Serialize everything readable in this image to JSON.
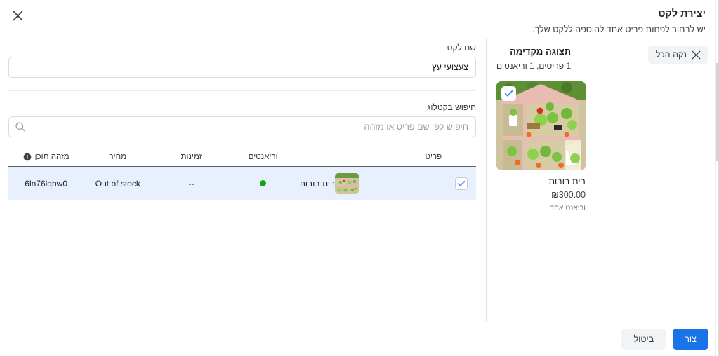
{
  "header": {
    "title": "יצירת לקט",
    "subtitle": "יש לבחור לפחות פריט אחד להוספה ללקט שלך.",
    "close_label": "×"
  },
  "form": {
    "name_label": "שם לקט",
    "name_value": "צעצועי עץ",
    "search_label": "חיפוש בקטלוג",
    "search_placeholder": "חיפוש לפי שם פריט או מזהה",
    "search_value": ""
  },
  "table": {
    "columns": [
      {
        "key": "check",
        "label": ""
      },
      {
        "key": "item",
        "label": "פריט"
      },
      {
        "key": "variants",
        "label": "וריאנטים"
      },
      {
        "key": "availability",
        "label": "זמינות"
      },
      {
        "key": "price",
        "label": "מחיר"
      },
      {
        "key": "content_id",
        "label": "מזהה תוכן"
      }
    ],
    "rows": [
      {
        "selected": true,
        "item_name": "בית בובות",
        "variants": "dot-green",
        "availability": "--",
        "price": "Out of stock",
        "content_id": "6ln76lqhw0"
      }
    ]
  },
  "preview": {
    "title": "תצוגה מקדימה",
    "subtitle": "1 פריטים, 1 וריאנטים",
    "clear_all_label": "נקה הכל",
    "card": {
      "title": "בית בובות",
      "price": "₪300.00",
      "variants": "וריאנט אחד"
    }
  },
  "footer": {
    "create_label": "צור",
    "cancel_label": "ביטול"
  },
  "colors": {
    "accent": "#1a73e8",
    "row_selected": "#e8f0fe",
    "dot_green": "#0ca90c",
    "border": "#dadce0"
  }
}
